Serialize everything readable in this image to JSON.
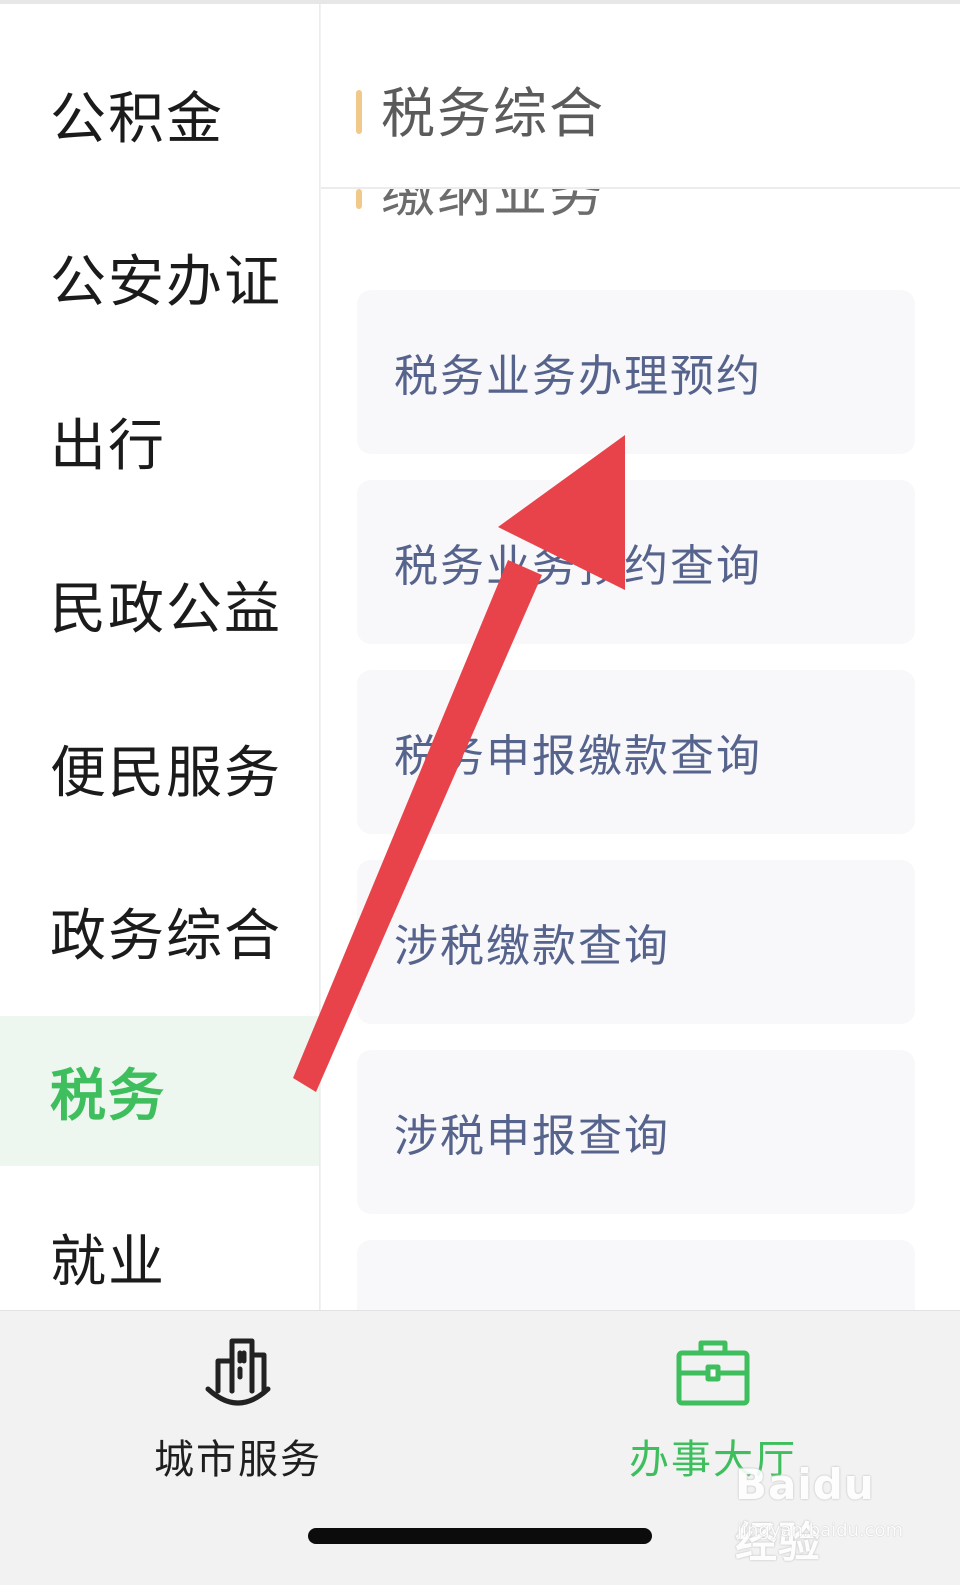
{
  "sidebar": {
    "items": [
      {
        "label": "公积金"
      },
      {
        "label": "公安办证"
      },
      {
        "label": "出行"
      },
      {
        "label": "民政公益"
      },
      {
        "label": "便民服务"
      },
      {
        "label": "政务综合"
      },
      {
        "label": "税务",
        "active": true
      },
      {
        "label": "就业"
      }
    ]
  },
  "main": {
    "section_title": "税务综合",
    "subsection_title": "缴纳业务",
    "cards": [
      {
        "label": "税务业务办理预约"
      },
      {
        "label": "税务业务预约查询"
      },
      {
        "label": "税务申报缴款查询"
      },
      {
        "label": "涉税缴款查询"
      },
      {
        "label": "涉税申报查询"
      },
      {
        "label": ""
      }
    ]
  },
  "tabbar": {
    "tabs": [
      {
        "label": "城市服务",
        "icon": "city-buildings-icon",
        "active": false
      },
      {
        "label": "办事大厅",
        "icon": "briefcase-icon",
        "active": true
      }
    ]
  },
  "watermark": {
    "logo": "Baidu经验",
    "url": "jingyan.baidu.com"
  },
  "colors": {
    "accent_green": "#3fbe5d",
    "annotation_arrow": "#e8434a",
    "header_bar": "#f1c98b",
    "card_text": "#56638c"
  }
}
